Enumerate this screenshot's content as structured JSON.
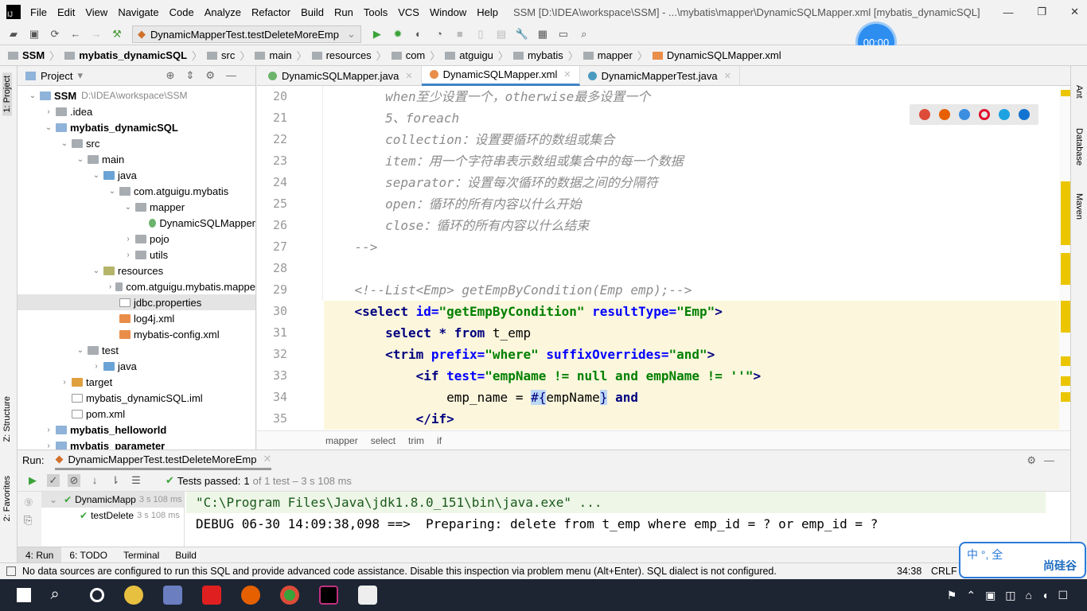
{
  "window": {
    "title": "SSM [D:\\IDEA\\workspace\\SSM] - ...\\mybatis\\mapper\\DynamicSQLMapper.xml [mybatis_dynamicSQL]",
    "logo": "IJ"
  },
  "menu": [
    "File",
    "Edit",
    "View",
    "Navigate",
    "Code",
    "Analyze",
    "Refactor",
    "Build",
    "Run",
    "Tools",
    "VCS",
    "Window",
    "Help"
  ],
  "toolbar": {
    "run_config": "DynamicMapperTest.testDeleteMoreEmp",
    "timer": "00:00"
  },
  "breadcrumb": [
    "SSM",
    "mybatis_dynamicSQL",
    "src",
    "main",
    "resources",
    "com",
    "atguigu",
    "mybatis",
    "mapper",
    "DynamicSQLMapper.xml"
  ],
  "left_strip": {
    "project": "1: Project",
    "structure": "Z: Structure",
    "favorites": "2: Favorites"
  },
  "right_strip": {
    "ant": "Ant",
    "database": "Database",
    "maven": "Maven"
  },
  "project": {
    "title": "Project",
    "items": [
      {
        "label": "SSM",
        "extra": "D:\\IDEA\\workspace\\SSM",
        "level": 0,
        "arrow": "down",
        "icon": "module",
        "bold": true
      },
      {
        "label": ".idea",
        "level": 1,
        "arrow": "right",
        "icon": "folder"
      },
      {
        "label": "mybatis_dynamicSQL",
        "level": 1,
        "arrow": "down",
        "icon": "module",
        "bold": true
      },
      {
        "label": "src",
        "level": 2,
        "arrow": "down",
        "icon": "folder"
      },
      {
        "label": "main",
        "level": 3,
        "arrow": "down",
        "icon": "folder"
      },
      {
        "label": "java",
        "level": 4,
        "arrow": "down",
        "icon": "src"
      },
      {
        "label": "com.atguigu.mybatis",
        "level": 5,
        "arrow": "down",
        "icon": "folder"
      },
      {
        "label": "mapper",
        "level": 6,
        "arrow": "down",
        "icon": "folder"
      },
      {
        "label": "DynamicSQLMapper",
        "level": 7,
        "arrow": "",
        "icon": "iface"
      },
      {
        "label": "pojo",
        "level": 6,
        "arrow": "right",
        "icon": "folder"
      },
      {
        "label": "utils",
        "level": 6,
        "arrow": "right",
        "icon": "folder"
      },
      {
        "label": "resources",
        "level": 4,
        "arrow": "down",
        "icon": "res"
      },
      {
        "label": "com.atguigu.mybatis.mappe",
        "level": 5,
        "arrow": "right",
        "icon": "folder"
      },
      {
        "label": "jdbc.properties",
        "level": 5,
        "arrow": "",
        "icon": "file",
        "selected": true
      },
      {
        "label": "log4j.xml",
        "level": 5,
        "arrow": "",
        "icon": "xml"
      },
      {
        "label": "mybatis-config.xml",
        "level": 5,
        "arrow": "",
        "icon": "xml"
      },
      {
        "label": "test",
        "level": 3,
        "arrow": "down",
        "icon": "folder"
      },
      {
        "label": "java",
        "level": 4,
        "arrow": "right",
        "icon": "src"
      },
      {
        "label": "target",
        "level": 2,
        "arrow": "right",
        "icon": "excl"
      },
      {
        "label": "mybatis_dynamicSQL.iml",
        "level": 2,
        "arrow": "",
        "icon": "file"
      },
      {
        "label": "pom.xml",
        "level": 2,
        "arrow": "",
        "icon": "file"
      },
      {
        "label": "mybatis_helloworld",
        "level": 1,
        "arrow": "right",
        "icon": "module",
        "bold": true
      },
      {
        "label": "mybatis_parameter",
        "level": 1,
        "arrow": "right",
        "icon": "module",
        "bold": true
      }
    ]
  },
  "editor": {
    "tabs": [
      {
        "label": "DynamicSQLMapper.java",
        "active": false
      },
      {
        "label": "DynamicSQLMapper.xml",
        "active": true
      },
      {
        "label": "DynamicMapperTest.java",
        "active": false
      }
    ],
    "lines": [
      {
        "n": "20",
        "hl": false,
        "tokens": [
          [
            "        when至少设置一个，otherwise最多设置一个",
            "cm"
          ]
        ]
      },
      {
        "n": "21",
        "hl": false,
        "tokens": [
          [
            "        5、foreach",
            "cm"
          ]
        ]
      },
      {
        "n": "22",
        "hl": false,
        "tokens": [
          [
            "        collection：设置要循环的数组或集合",
            "cm"
          ]
        ]
      },
      {
        "n": "23",
        "hl": false,
        "tokens": [
          [
            "        item：用一个字符串表示数组或集合中的每一个数据",
            "cm"
          ]
        ]
      },
      {
        "n": "24",
        "hl": false,
        "tokens": [
          [
            "        separator：设置每次循环的数据之间的分隔符",
            "cm"
          ]
        ]
      },
      {
        "n": "25",
        "hl": false,
        "tokens": [
          [
            "        open：循环的所有内容以什么开始",
            "cm"
          ]
        ]
      },
      {
        "n": "26",
        "hl": false,
        "tokens": [
          [
            "        close：循环的所有内容以什么结束",
            "cm"
          ]
        ]
      },
      {
        "n": "27",
        "hl": false,
        "tokens": [
          [
            "    -->",
            "cm"
          ]
        ]
      },
      {
        "n": "28",
        "hl": false,
        "tokens": []
      },
      {
        "n": "29",
        "hl": false,
        "tokens": [
          [
            "    <!--List<Emp> getEmpByCondition(Emp emp);-->",
            "cm"
          ]
        ]
      },
      {
        "n": "30",
        "hl": true,
        "tokens": [
          [
            "    <select ",
            "tag"
          ],
          [
            "id=",
            "attr"
          ],
          [
            "\"getEmpByCondition\" ",
            "val"
          ],
          [
            "resultType=",
            "attr"
          ],
          [
            "\"Emp\"",
            "val"
          ],
          [
            ">",
            "tag"
          ]
        ]
      },
      {
        "n": "31",
        "hl": true,
        "tokens": [
          [
            "        select * from ",
            "kw"
          ],
          [
            "t_emp",
            "pl"
          ]
        ]
      },
      {
        "n": "32",
        "hl": true,
        "tokens": [
          [
            "        <trim ",
            "tag"
          ],
          [
            "prefix=",
            "attr"
          ],
          [
            "\"where\" ",
            "val"
          ],
          [
            "suffixOverrides=",
            "attr"
          ],
          [
            "\"and\"",
            "val"
          ],
          [
            ">",
            "tag"
          ]
        ]
      },
      {
        "n": "33",
        "hl": true,
        "tokens": [
          [
            "            <if ",
            "tag"
          ],
          [
            "test=",
            "attr"
          ],
          [
            "\"empName != null and empName != ''\"",
            "val"
          ],
          [
            ">",
            "tag"
          ]
        ]
      },
      {
        "n": "34",
        "hl": true,
        "tokens": [
          [
            "                emp_name = ",
            "pl"
          ],
          [
            "#{",
            "sel"
          ],
          [
            "empName",
            "pl"
          ],
          [
            "}",
            "sel"
          ],
          [
            " and",
            "kw"
          ]
        ]
      },
      {
        "n": "35",
        "hl": true,
        "tokens": [
          [
            "            </if>",
            "tag"
          ]
        ]
      }
    ],
    "breadcrumb": [
      "mapper",
      "select",
      "trim",
      "if"
    ]
  },
  "run": {
    "label": "Run:",
    "tab": "DynamicMapperTest.testDeleteMoreEmp",
    "tests_passed_label": "Tests passed:",
    "passed": "1",
    "of_text": "of 1 test – 3 s 108 ms",
    "tree": [
      {
        "label": "DynamicMapp",
        "time": "3 s 108 ms"
      },
      {
        "label": "testDelete",
        "time": "3 s 108 ms"
      }
    ],
    "console": [
      "\"C:\\Program Files\\Java\\jdk1.8.0_151\\bin\\java.exe\" ...",
      "DEBUG 06-30 14:09:38,098 ==>  Preparing: delete from t_emp where emp_id = ? or emp_id = ?"
    ]
  },
  "bottom_tabs": [
    "4: Run",
    "6: TODO",
    "Terminal",
    "Build"
  ],
  "status": {
    "message": "No data sources are configured to run this SQL and provide advanced code assistance. Disable this inspection via problem menu (Alt+Enter). SQL dialect is not configured.",
    "position": "34:38",
    "line_sep": "CRLF"
  },
  "ime": {
    "text": "中 °, 全",
    "brand": "尚硅谷"
  },
  "colors": {
    "accent": "#4083c9",
    "tag": "#000080",
    "attr": "#0000ff",
    "value": "#008000",
    "comment": "#8c8c8c",
    "highlight": "#fcf6dc",
    "taskbar": "#1d2533"
  }
}
